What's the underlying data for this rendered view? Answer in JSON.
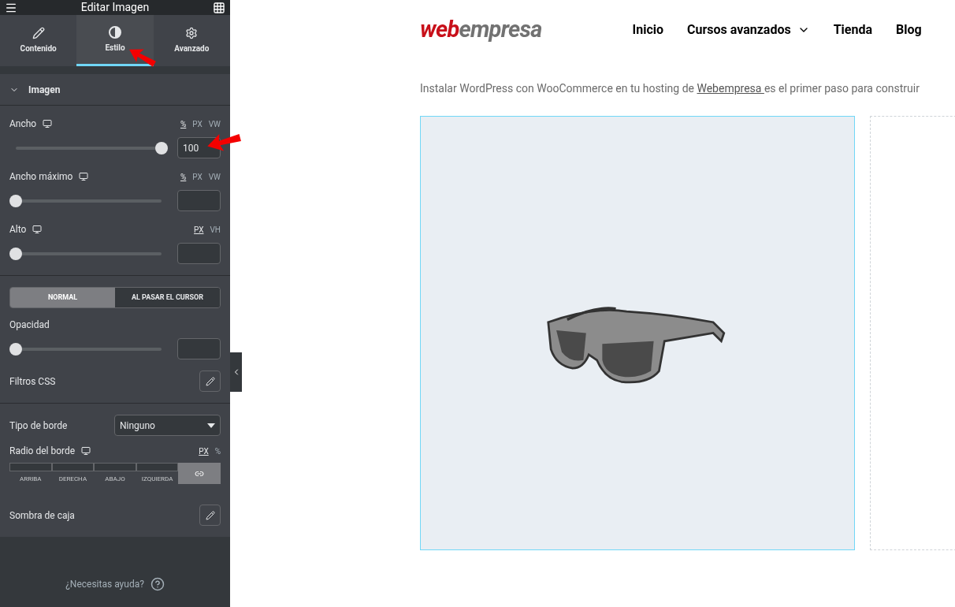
{
  "panel": {
    "title": "Editar Imagen",
    "tabs": [
      {
        "label": "Contenido",
        "selected": false
      },
      {
        "label": "Estilo",
        "selected": true
      },
      {
        "label": "Avanzado",
        "selected": false
      }
    ],
    "section": {
      "title": "Imagen",
      "expanded": true
    },
    "sliders": [
      {
        "label": "Ancho",
        "units": [
          {
            "label": "%",
            "selected": true
          },
          {
            "label": "PX",
            "selected": false
          },
          {
            "label": "VW",
            "selected": false
          }
        ],
        "level": 1,
        "value": "100"
      },
      {
        "label": "Ancho máximo",
        "units": [
          {
            "label": "%",
            "selected": true
          },
          {
            "label": "PX",
            "selected": false
          },
          {
            "label": "VW",
            "selected": false
          }
        ],
        "level": 0
      },
      {
        "label": "Alto",
        "units": [
          {
            "label": "PX",
            "selected": true
          },
          {
            "label": "VH",
            "selected": false
          }
        ],
        "level": 0
      }
    ],
    "state_tabs": [
      {
        "label": "NORMAL",
        "selected": true
      },
      {
        "label": "AL PASAR EL CURSOR",
        "selected": false
      }
    ],
    "opacity": {
      "label": "Opacidad",
      "level": 0
    },
    "css_filters": {
      "label": "Filtros CSS"
    },
    "border_type": {
      "label": "Tipo de borde",
      "value": "Ninguno"
    },
    "border_radius": {
      "label": "Radio del borde",
      "units": [
        {
          "label": "PX",
          "selected": true
        },
        {
          "label": "%",
          "selected": false
        }
      ],
      "sides": [
        "ARRIBA",
        "DERECHA",
        "ABAJO",
        "IZQUIERDA"
      ],
      "linked": true
    },
    "box_shadow": {
      "label": "Sombra de caja"
    },
    "help": "¿Necesitas ayuda?"
  },
  "site": {
    "logo": {
      "part_1": "web",
      "part_2": "empresa"
    },
    "nav": [
      {
        "label": "Inicio",
        "has_dropdown": false
      },
      {
        "label": "Cursos avanzados",
        "has_dropdown": true
      },
      {
        "label": "Tienda",
        "has_dropdown": false
      },
      {
        "label": "Blog",
        "has_dropdown": false
      }
    ],
    "intro": {
      "before": "Instalar WordPress con WooCommerce en tu hosting de ",
      "link": "Webempresa ",
      "after": "es el primer paso para construir"
    }
  }
}
